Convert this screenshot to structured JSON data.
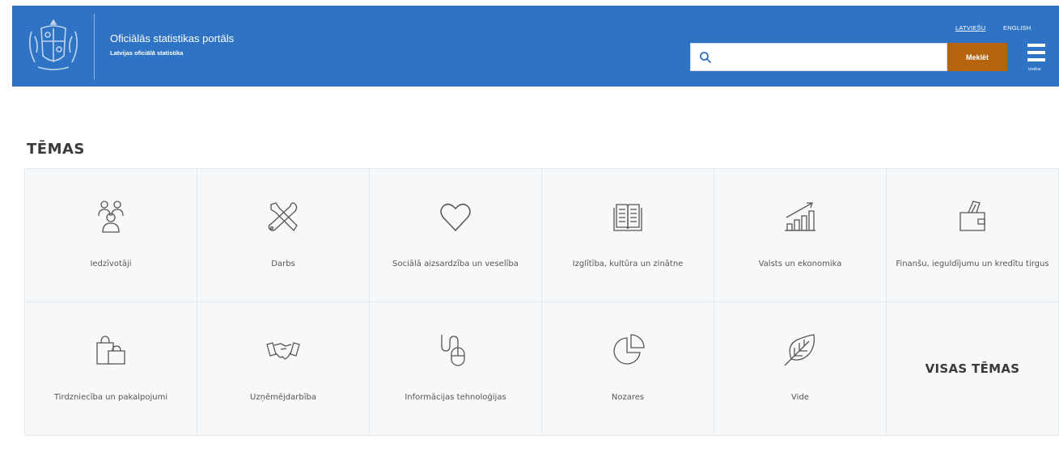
{
  "header": {
    "title": "Oficiālās statistikas portāls",
    "subtitle": "Latvijas oficiālā statistika",
    "lang_lv": "LATVIEŠU",
    "lang_en": "ENGLISH",
    "search_value": "",
    "search_button": "Meklēt",
    "menu_label": "Izvēlne"
  },
  "section_title": "TĒMAS",
  "topics": [
    {
      "label": "Iedzīvotāji",
      "icon": "people-icon"
    },
    {
      "label": "Darbs",
      "icon": "tools-icon"
    },
    {
      "label": "Sociālā aizsardzība un veselība",
      "icon": "heart-icon"
    },
    {
      "label": "Izglītība, kultūra un zinātne",
      "icon": "book-icon"
    },
    {
      "label": "Valsts un ekonomika",
      "icon": "growth-chart-icon"
    },
    {
      "label": "Finanšu, ieguldījumu un kredītu tirgus",
      "icon": "wallet-icon"
    },
    {
      "label": "Tirdzniecība un pakalpojumi",
      "icon": "shopping-bags-icon"
    },
    {
      "label": "Uzņēmējdarbība",
      "icon": "handshake-icon"
    },
    {
      "label": "Informācijas tehnoloģijas",
      "icon": "mouse-icon"
    },
    {
      "label": "Nozares",
      "icon": "pie-chart-icon"
    },
    {
      "label": "Vide",
      "icon": "leaf-icon"
    }
  ],
  "all_topics": "VISAS TĒMAS"
}
